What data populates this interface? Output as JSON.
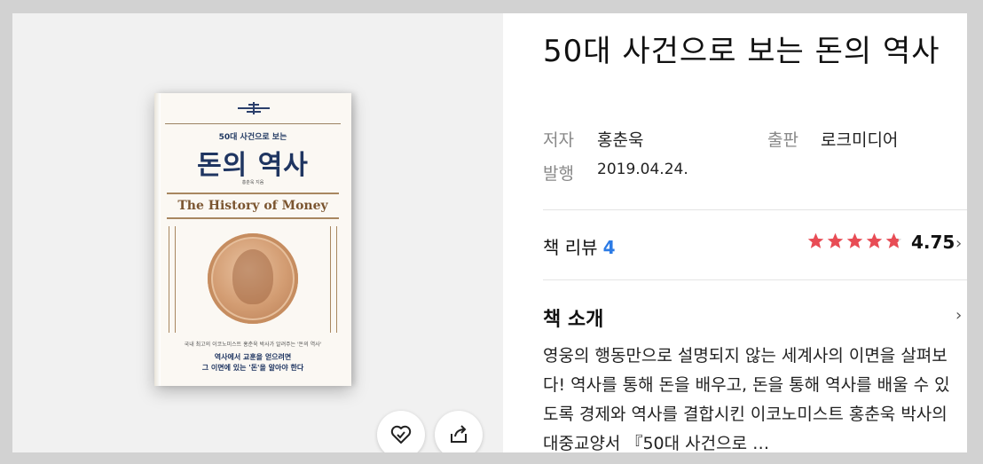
{
  "book": {
    "title": "50대 사건으로 보는 돈의 역사",
    "author_label": "저자",
    "author": "홍춘욱",
    "publisher_label": "출판",
    "publisher": "로크미디어",
    "date_label": "발행",
    "date": "2019.04.24."
  },
  "cover": {
    "subtitle": "50대 사건으로 보는",
    "title": "돈의 역사",
    "author_line": "홍춘욱 지음",
    "english_title": "The History of Money",
    "blurb": "국내 최고의 이코노미스트 홍춘욱 박사가 알려주는 '돈의 역사'",
    "tagline1": "역사에서 교훈을 얻으려면",
    "tagline2": "그 이면에 있는 '돈'을 알아야 한다"
  },
  "review": {
    "label": "책 리뷰",
    "count": "4",
    "rating": 4.75,
    "rating_text": "4.75",
    "star_color": "#e84c55"
  },
  "intro": {
    "title": "책 소개",
    "text": "영웅의 행동만으로 설명되지 않는 세계사의 이면을 살펴보다! 역사를 통해 돈을 배우고, 돈을 통해 역사를 배울 수 있도록 경제와 역사를 결합시킨 이코노미스트 홍춘욱 박사의 대중교양서 『50대 사건으로 …"
  },
  "icons": {
    "like": "heart-check-icon",
    "share": "share-icon",
    "chevron": "chevron-right-icon"
  }
}
